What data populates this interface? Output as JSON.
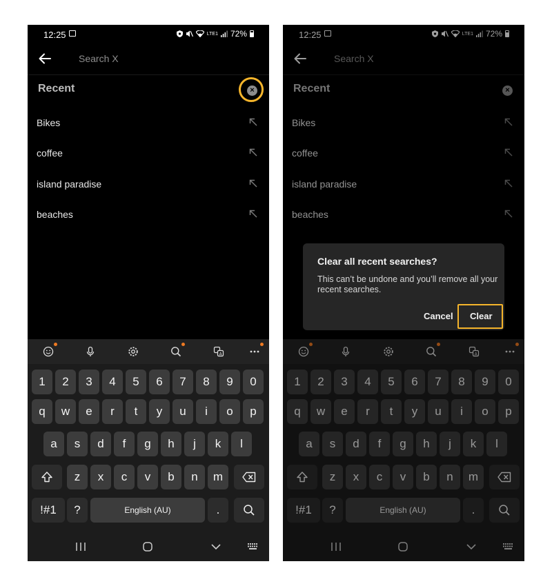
{
  "status": {
    "time": "12:25",
    "network_label": "LTE1",
    "battery": "72%"
  },
  "search": {
    "placeholder": "Search X"
  },
  "recent": {
    "header": "Recent",
    "items": [
      "Bikes",
      "coffee",
      "island paradise",
      "beaches"
    ]
  },
  "dialog": {
    "title": "Clear all recent searches?",
    "body": "This can’t be undone and you’ll remove all your recent searches.",
    "cancel": "Cancel",
    "clear": "Clear"
  },
  "keyboard": {
    "row_numbers": [
      "1",
      "2",
      "3",
      "4",
      "5",
      "6",
      "7",
      "8",
      "9",
      "0"
    ],
    "row_top": [
      "q",
      "w",
      "e",
      "r",
      "t",
      "y",
      "u",
      "i",
      "o",
      "p"
    ],
    "row_middle": [
      "a",
      "s",
      "d",
      "f",
      "g",
      "h",
      "j",
      "k",
      "l"
    ],
    "row_bottom": [
      "z",
      "x",
      "c",
      "v",
      "b",
      "n",
      "m"
    ],
    "symbols_key": "!#1",
    "question_key": "?",
    "space_label": "English (AU)",
    "period_key": "."
  },
  "colors": {
    "highlight": "#f6b52b",
    "notification_dot": "#ef7a22"
  }
}
